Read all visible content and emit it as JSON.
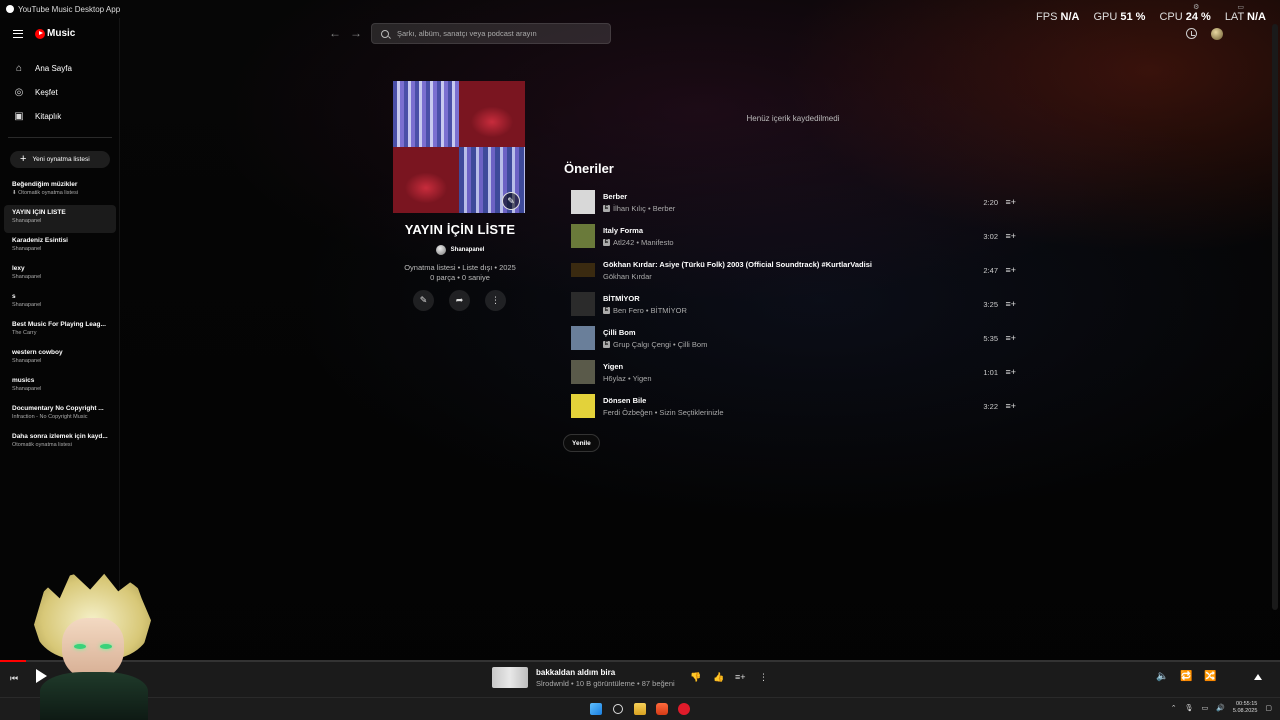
{
  "window": {
    "title": "YouTube Music Desktop App"
  },
  "stats": [
    {
      "label": "FPS",
      "value": "N/A"
    },
    {
      "label": "GPU",
      "value": "51 %"
    },
    {
      "label": "CPU",
      "value": "24 %"
    },
    {
      "label": "LAT",
      "value": "N/A"
    }
  ],
  "brand": {
    "name": "Music"
  },
  "sidebar": {
    "nav": [
      {
        "label": "Ana Sayfa",
        "icon": "home-icon"
      },
      {
        "label": "Keşfet",
        "icon": "compass-icon"
      },
      {
        "label": "Kitaplık",
        "icon": "library-icon"
      }
    ],
    "new_playlist_label": "Yeni oynatma listesi",
    "playlists": [
      {
        "name": "Beğendiğim müzikler",
        "sub": "Otomatik oynatma listesi",
        "pinned": true
      },
      {
        "name": "YAYIN İÇİN LİSTE",
        "sub": "Shanapanel",
        "active": true
      },
      {
        "name": "Karadeniz Esintisi",
        "sub": "Shanapanel"
      },
      {
        "name": "lexy",
        "sub": "Shanapanel"
      },
      {
        "name": "s",
        "sub": "Shanapanel"
      },
      {
        "name": "Best Music For Playing Leag...",
        "sub": "The Carry"
      },
      {
        "name": "western cowboy",
        "sub": "Shanapanel"
      },
      {
        "name": "musics",
        "sub": "Shanapanel"
      },
      {
        "name": "Documentary No Copyright ...",
        "sub": "Infraction - No Copyright Music"
      },
      {
        "name": "Daha sonra izlemek için kayd...",
        "sub": "Otomatik oynatma listesi"
      }
    ]
  },
  "search": {
    "placeholder": "Şarkı, albüm, sanatçı veya podcast arayın"
  },
  "playlist": {
    "title": "YAYIN İÇİN LİSTE",
    "owner": "Shanapanel",
    "meta_line1": "Oynatma listesi • Liste dışı • 2025",
    "meta_line2": "0 parça • 0 saniye",
    "empty_message": "Henüz içerik kaydedilmedi"
  },
  "recommendations": {
    "title": "Öneriler",
    "refresh_label": "Yenile",
    "tracks": [
      {
        "title": "Berber",
        "subtitle": "İlhan Kılıç • Berber",
        "explicit": true,
        "duration": "2:20",
        "thumb": "#d8d8d8"
      },
      {
        "title": "Italy Forma",
        "subtitle": "Atl242 • Manifesto",
        "explicit": true,
        "duration": "3:02",
        "thumb": "#6a7a3a"
      },
      {
        "title": "Gökhan Kırdar: Asiye (Türkü Folk) 2003 (Official Soundtrack) #KurtlarVadisi",
        "subtitle": "Gökhan Kırdar",
        "explicit": false,
        "duration": "2:47",
        "thumb": "#3a2a10",
        "wide": true
      },
      {
        "title": "BİTMİYOR",
        "subtitle": "Ben Fero • BİTMİYOR",
        "explicit": true,
        "duration": "3:25",
        "thumb": "#2b2b2b"
      },
      {
        "title": "Çilli Bom",
        "subtitle": "Grup Çalgı Çengi • Çilli Bom",
        "explicit": true,
        "duration": "5:35",
        "thumb": "#6a7f9a"
      },
      {
        "title": "Yigen",
        "subtitle": "H6ylaz • Yigen",
        "explicit": false,
        "duration": "1:01",
        "thumb": "#5a5a4a"
      },
      {
        "title": "Dönsen Bile",
        "subtitle": "Ferdi Özbeğen • Sizin Seçtiklerinizle",
        "explicit": false,
        "duration": "3:22",
        "thumb": "#e3d23a"
      }
    ]
  },
  "player": {
    "title": "bakkaldan aldım bira",
    "subtitle": "Slrodwnld • 10 B görüntüleme • 87 beğeni",
    "progress": 0.02
  },
  "taskbar": {
    "time": "00:55:15",
    "date": "5.08.2025"
  },
  "colors": {
    "accent": "#ff0000",
    "background": "#030303",
    "player_bg": "#1b1b1b"
  }
}
